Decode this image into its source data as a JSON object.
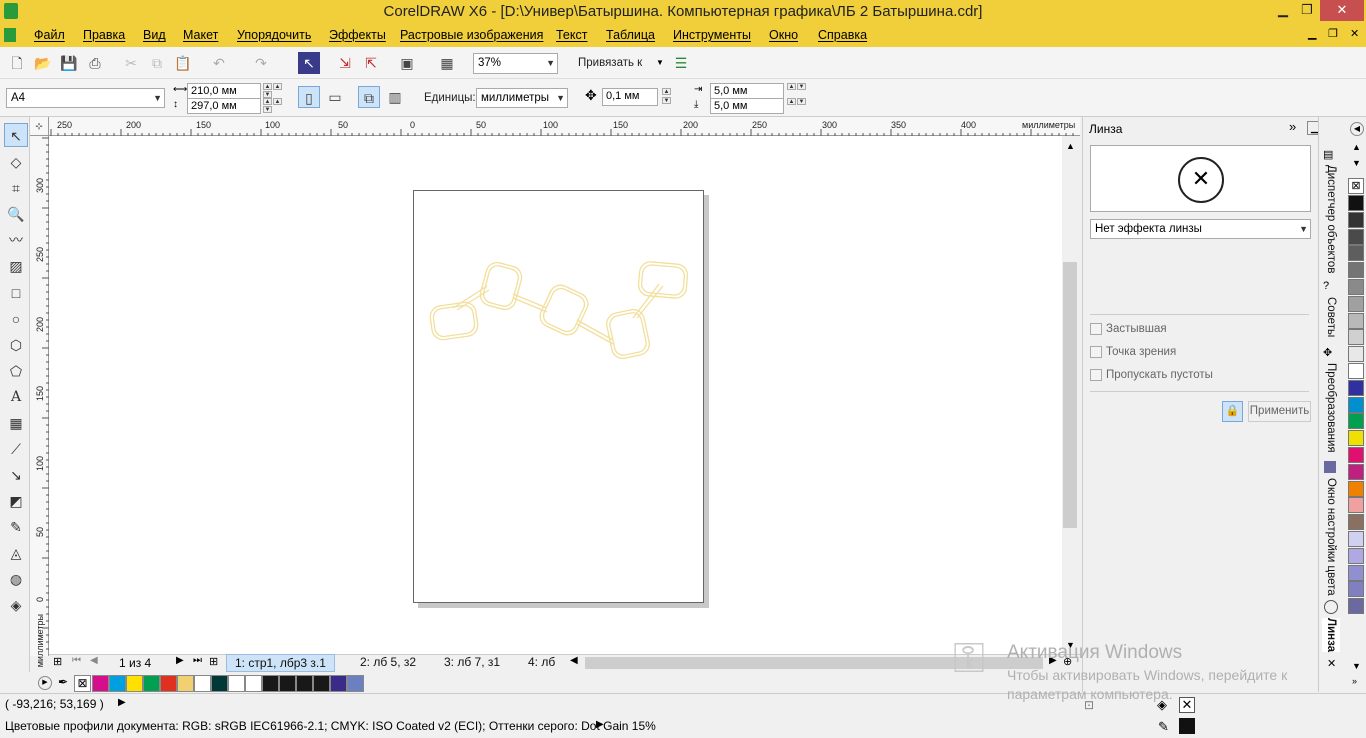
{
  "window": {
    "title": "CorelDRAW X6 - [D:\\Универ\\Батыршина. Компьютерная графика\\ЛБ 2 Батыршина.cdr]"
  },
  "menu": [
    "Файл",
    "Правка",
    "Вид",
    "Макет",
    "Упорядочить",
    "Эффекты",
    "Растровые изображения",
    "Текст",
    "Таблица",
    "Инструменты",
    "Окно",
    "Справка"
  ],
  "toolbar": {
    "zoom": "37%",
    "snap_label": "Привязать к"
  },
  "propbar": {
    "page_size": "A4",
    "width": "210,0 мм",
    "height": "297,0 мм",
    "units_label": "Единицы:",
    "units_value": "миллиметры",
    "nudge": "0,1 мм",
    "dup_x": "5,0 мм",
    "dup_y": "5,0 мм"
  },
  "ruler": {
    "h_labels": [
      "250",
      "200",
      "150",
      "100",
      "50",
      "0",
      "50",
      "100",
      "150",
      "200",
      "250",
      "300",
      "350",
      "400"
    ],
    "h_unit": "миллиметры",
    "v_labels": [
      "300",
      "250",
      "200",
      "150",
      "100",
      "50",
      "0"
    ],
    "v_unit": "миллиметры"
  },
  "pages": {
    "counter": "1 из 4",
    "tabs": [
      "1: стр1, лбр3 з.1",
      "2: лб 5, з2",
      "3: лб 7, з1",
      "4: лб"
    ]
  },
  "palette_bottom": [
    "#d40e8c",
    "#00a0e0",
    "#ffe000",
    "#00a050",
    "#e03020",
    "#f0d070",
    "#ffffff",
    "#003838",
    "#ffffff",
    "#ffffff",
    "#181818",
    "#181818",
    "#181818",
    "#181818",
    "#3a2a8a",
    "#6a80c0"
  ],
  "status": {
    "coords": "( -93,216; 53,169 )",
    "profiles": "Цветовые профили документа: RGB: sRGB IEC61966-2.1; CMYK: ISO Coated v2 (ECI); Оттенки серого: Dot Gain 15%"
  },
  "docker": {
    "title": "Линза",
    "effect": "Нет эффекта линзы",
    "frozen": "Застывшая",
    "viewpoint": "Точка зрения",
    "skip_blank": "Пропускать пустоты",
    "apply": "Применить"
  },
  "docker_tabs": [
    "Диспетчер объектов",
    "Советы",
    "Преобразования",
    "Окно настройки цвета",
    "Линза"
  ],
  "palette_right": [
    "#111111",
    "#333333",
    "#4a4a4a",
    "#5e5e5e",
    "#747474",
    "#8a8a8a",
    "#a0a0a0",
    "#b8b8b8",
    "#d0d0d0",
    "#e8e8e8",
    "#ffffff",
    "#3030a0",
    "#0090d0",
    "#00a050",
    "#f0e000",
    "#e01070",
    "#c02080",
    "#f08000",
    "#f0a0a0",
    "#8a7060",
    "#d0d0f0",
    "#b0a8e0",
    "#9090d0",
    "#8080c0",
    "#6a6aa0"
  ],
  "watermark": {
    "line1": "Активация Windows",
    "line2": "Чтобы активировать Windows, перейдите к",
    "line3": "параметрам компьютера."
  }
}
